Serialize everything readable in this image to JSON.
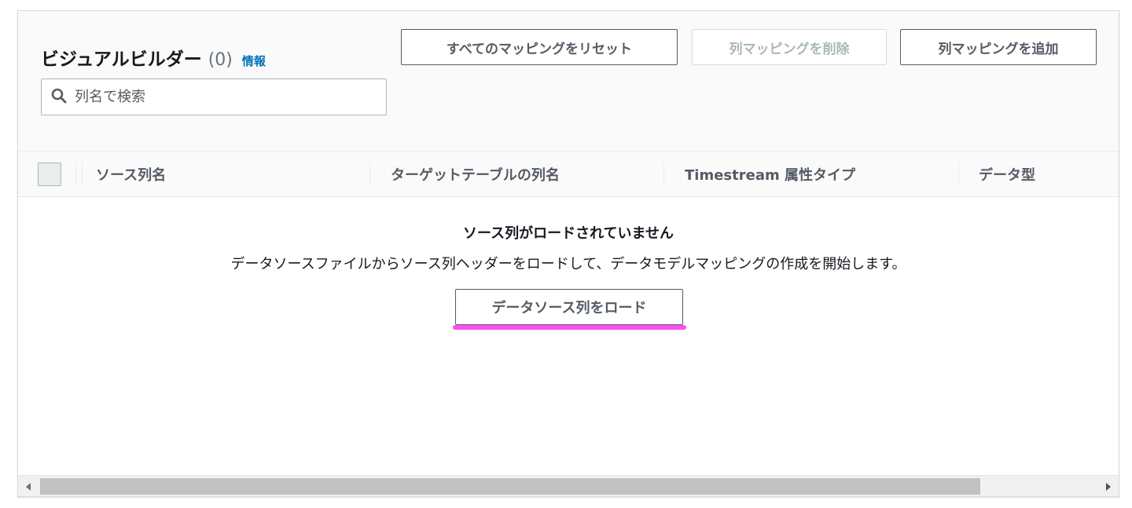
{
  "header": {
    "title": "ビジュアルビルダー",
    "count": "(0)",
    "info_link": "情報",
    "search": {
      "placeholder": "列名で検索",
      "icon": "search-icon"
    },
    "buttons": {
      "reset_all": "すべてのマッピングをリセット",
      "delete_column_mapping": "列マッピングを削除",
      "add_column_mapping": "列マッピングを追加"
    }
  },
  "table": {
    "columns": [
      "ソース列名",
      "ターゲットテーブルの列名",
      "Timestream 属性タイプ",
      "データ型"
    ],
    "rows": []
  },
  "empty_state": {
    "title": "ソース列がロードされていません",
    "description": "データソースファイルからソース列ヘッダーをロードして、データモデルマッピングの作成を開始します。",
    "button": "データソース列をロード"
  },
  "colors": {
    "accent_link": "#0073bb",
    "highlight": "#ff4fef",
    "disabled_text": "#aab7b8"
  }
}
